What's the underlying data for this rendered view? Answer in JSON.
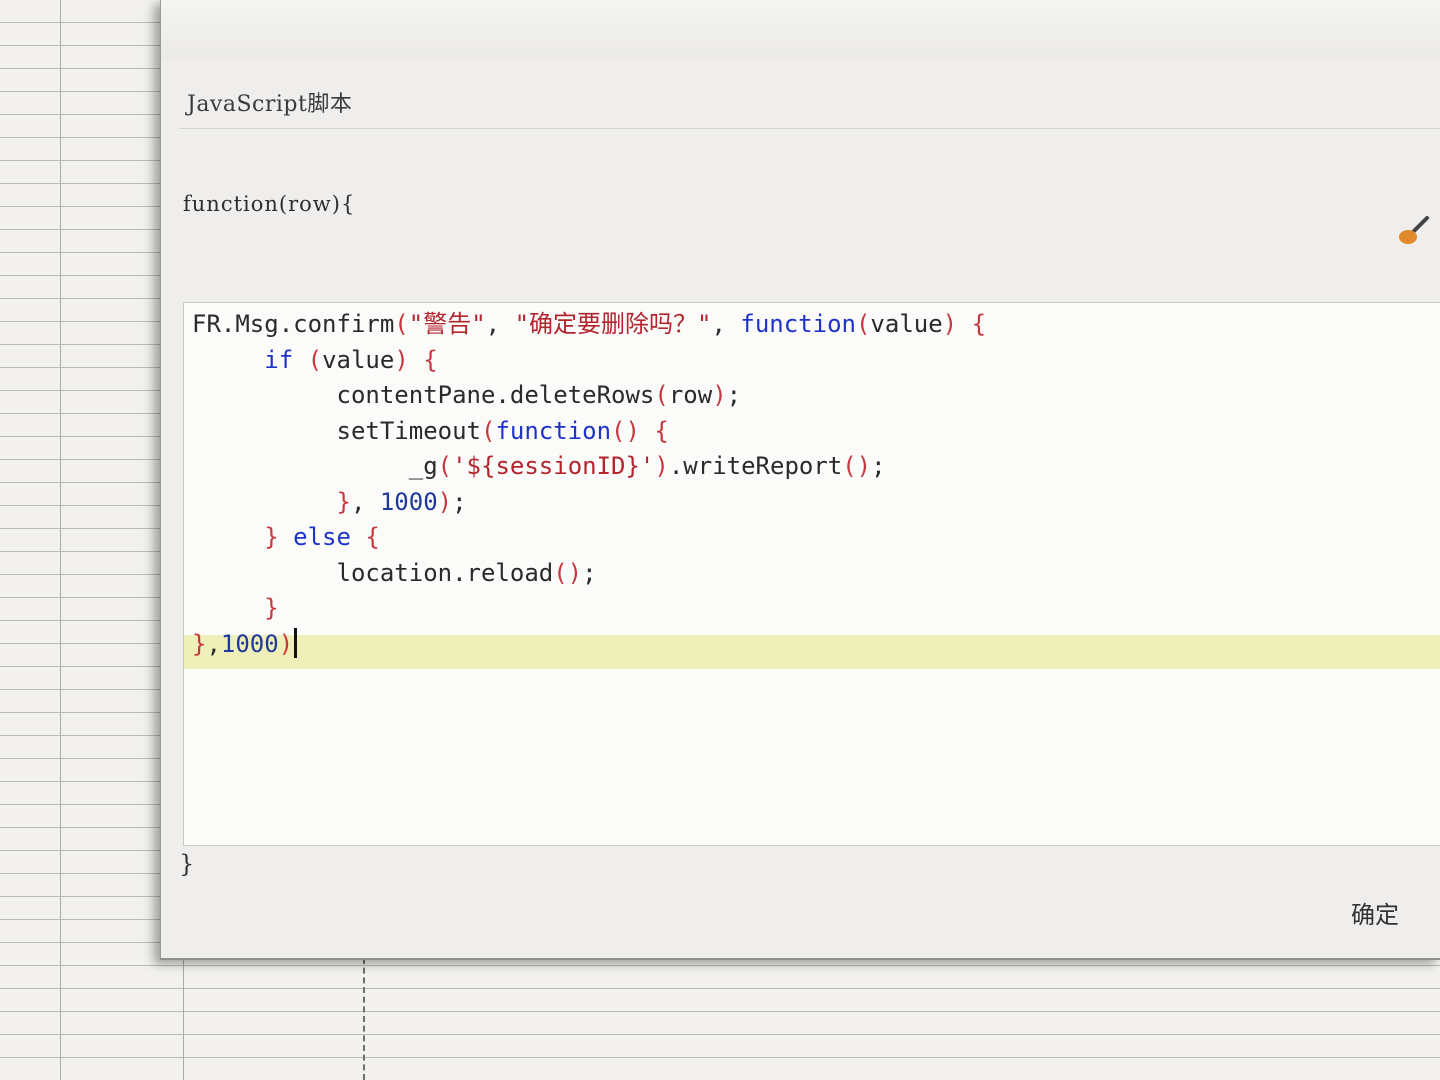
{
  "dialog": {
    "title": "JavaScript脚本",
    "header_signature": "function(row){",
    "footer_brace": "}",
    "ok_button_label": "确定"
  },
  "icons": {
    "brush": "brush-icon"
  },
  "editor": {
    "highlight_color": "#efefb9",
    "lines": [
      [
        {
          "t": "FR.Msg.confirm",
          "c": "plain"
        },
        {
          "t": "(",
          "c": "punc"
        },
        {
          "t": "\"警告\"",
          "c": "str"
        },
        {
          "t": ", ",
          "c": "plain"
        },
        {
          "t": "\"确定要删除吗？\"",
          "c": "str"
        },
        {
          "t": ", ",
          "c": "plain"
        },
        {
          "t": "function",
          "c": "kw"
        },
        {
          "t": "(",
          "c": "punc"
        },
        {
          "t": "value",
          "c": "plain"
        },
        {
          "t": ")",
          "c": "punc"
        },
        {
          "t": " {",
          "c": "punc"
        }
      ],
      [
        {
          "t": "     ",
          "c": "plain"
        },
        {
          "t": "if",
          "c": "kw"
        },
        {
          "t": " (",
          "c": "punc"
        },
        {
          "t": "value",
          "c": "plain"
        },
        {
          "t": ")",
          "c": "punc"
        },
        {
          "t": " {",
          "c": "punc"
        }
      ],
      [
        {
          "t": "          contentPane.deleteRows",
          "c": "plain"
        },
        {
          "t": "(",
          "c": "punc"
        },
        {
          "t": "row",
          "c": "plain"
        },
        {
          "t": ")",
          "c": "punc"
        },
        {
          "t": ";",
          "c": "plain"
        }
      ],
      [
        {
          "t": "          setTimeout",
          "c": "plain"
        },
        {
          "t": "(",
          "c": "punc"
        },
        {
          "t": "function",
          "c": "kw"
        },
        {
          "t": "()",
          "c": "punc"
        },
        {
          "t": " {",
          "c": "punc"
        }
      ],
      [
        {
          "t": "               _g",
          "c": "plain"
        },
        {
          "t": "(",
          "c": "punc"
        },
        {
          "t": "'${sessionID}'",
          "c": "str"
        },
        {
          "t": ")",
          "c": "punc"
        },
        {
          "t": ".writeReport",
          "c": "plain"
        },
        {
          "t": "()",
          "c": "punc"
        },
        {
          "t": ";",
          "c": "plain"
        }
      ],
      [
        {
          "t": "          ",
          "c": "plain"
        },
        {
          "t": "}",
          "c": "punc"
        },
        {
          "t": ", ",
          "c": "plain"
        },
        {
          "t": "1000",
          "c": "num"
        },
        {
          "t": ")",
          "c": "punc"
        },
        {
          "t": ";",
          "c": "plain"
        }
      ],
      [
        {
          "t": "     ",
          "c": "plain"
        },
        {
          "t": "}",
          "c": "punc"
        },
        {
          "t": " ",
          "c": "plain"
        },
        {
          "t": "else",
          "c": "kw"
        },
        {
          "t": " {",
          "c": "punc"
        }
      ],
      [
        {
          "t": "          location.reload",
          "c": "plain"
        },
        {
          "t": "()",
          "c": "punc"
        },
        {
          "t": ";",
          "c": "plain"
        }
      ],
      [
        {
          "t": "     ",
          "c": "plain"
        },
        {
          "t": "}",
          "c": "punc"
        }
      ],
      [
        {
          "t": "}",
          "c": "punc"
        },
        {
          "t": ",",
          "c": "plain"
        },
        {
          "t": "1000",
          "c": "num"
        },
        {
          "t": ")",
          "c": "punc"
        }
      ]
    ]
  }
}
